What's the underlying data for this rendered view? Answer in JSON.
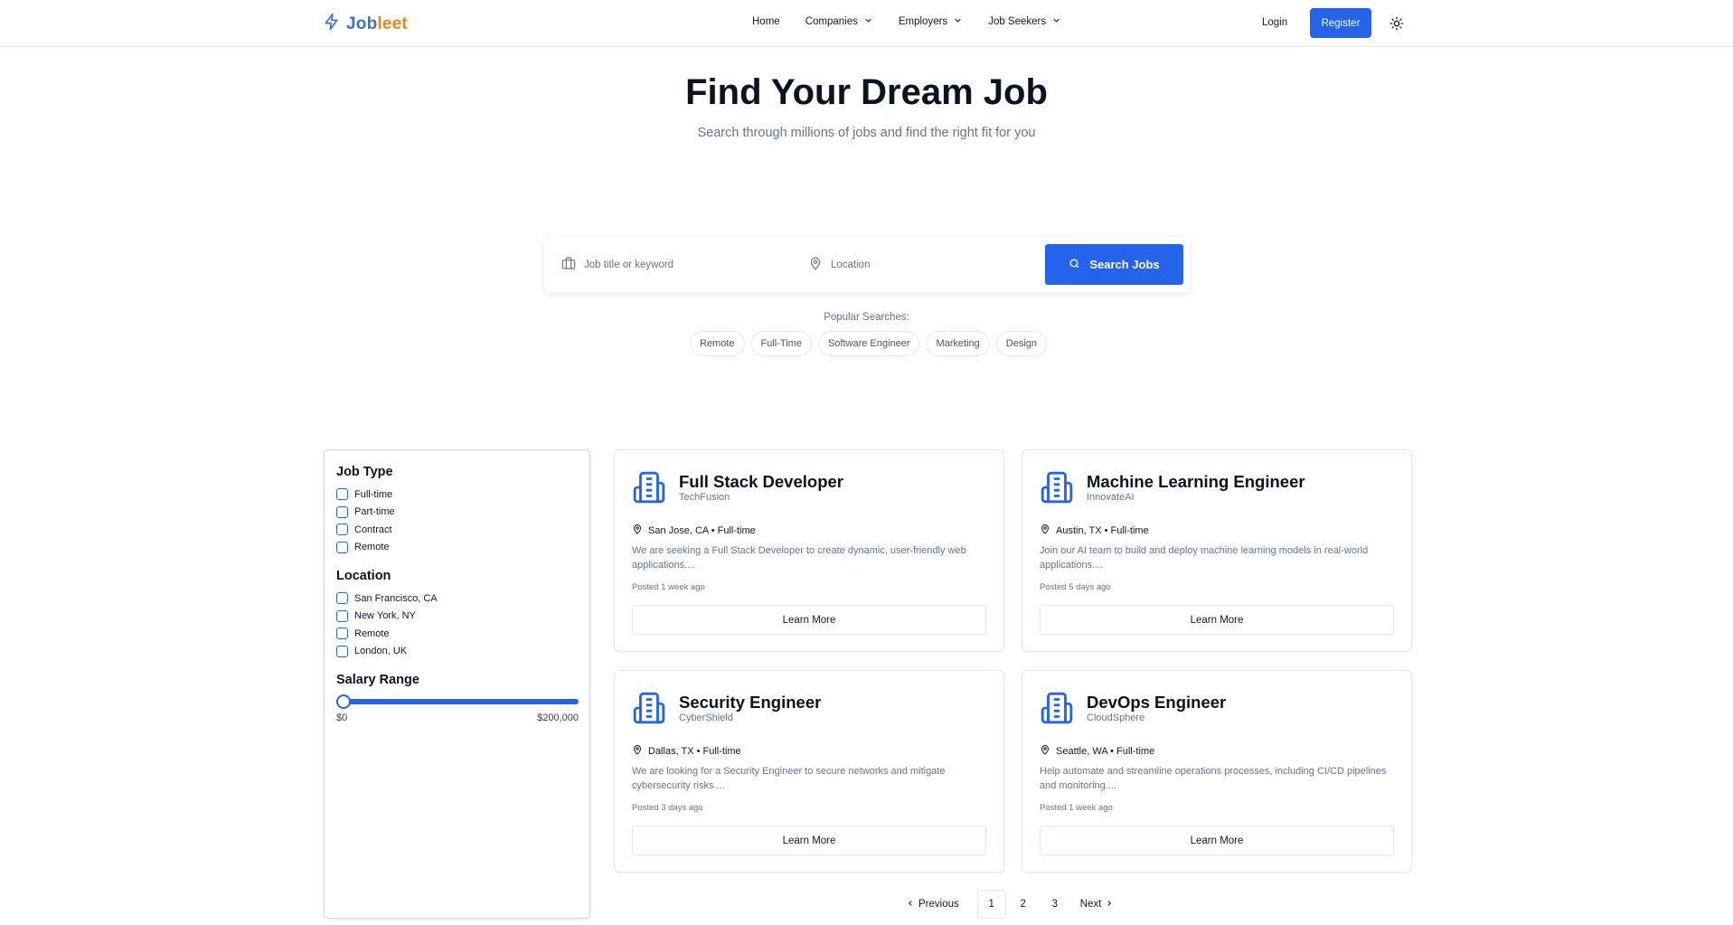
{
  "brand": {
    "part1": "Job",
    "part2": "leet",
    "color_primary": "#3b6fd6",
    "color_accent": "#e38a1d"
  },
  "nav": {
    "items": [
      {
        "label": "Home",
        "dropdown": false
      },
      {
        "label": "Companies",
        "dropdown": true
      },
      {
        "label": "Employers",
        "dropdown": true
      },
      {
        "label": "Job Seekers",
        "dropdown": true
      }
    ],
    "login": "Login",
    "register": "Register",
    "theme_icon": "sun-icon"
  },
  "hero": {
    "title": "Find Your Dream Job",
    "subtitle": "Search through millions of jobs and find the right fit for you"
  },
  "search": {
    "keyword_placeholder": "Job title or keyword",
    "location_placeholder": "Location",
    "button": "Search Jobs"
  },
  "popular": {
    "label": "Popular Searches:",
    "chips": [
      "Remote",
      "Full-Time",
      "Software Engineer",
      "Marketing",
      "Design"
    ]
  },
  "filters": {
    "job_type": {
      "title": "Job Type",
      "options": [
        "Full-time",
        "Part-time",
        "Contract",
        "Remote"
      ]
    },
    "location": {
      "title": "Location",
      "options": [
        "San Francisco, CA",
        "New York, NY",
        "Remote",
        "London, UK"
      ]
    },
    "salary": {
      "title": "Salary Range",
      "min_label": "$0",
      "max_label": "$200,000",
      "value_fraction": 0
    }
  },
  "jobs": [
    {
      "title": "Full Stack Developer",
      "company": "TechFusion",
      "meta": "San Jose, CA • Full-time",
      "description": "We are seeking a Full Stack Developer to create dynamic, user-friendly web applications....",
      "posted": "Posted 1 week ago",
      "cta": "Learn More"
    },
    {
      "title": "Machine Learning Engineer",
      "company": "InnovateAI",
      "meta": "Austin, TX • Full-time",
      "description": "Join our AI team to build and deploy machine learning models in real-world applications....",
      "posted": "Posted 5 days ago",
      "cta": "Learn More"
    },
    {
      "title": "Security Engineer",
      "company": "CyberShield",
      "meta": "Dallas, TX • Full-time",
      "description": "We are looking for a Security Engineer to secure networks and mitigate cybersecurity risks....",
      "posted": "Posted 3 days ago",
      "cta": "Learn More"
    },
    {
      "title": "DevOps Engineer",
      "company": "CloudSphere",
      "meta": "Seattle, WA • Full-time",
      "description": "Help automate and streamline operations processes, including CI/CD pipelines and monitoring....",
      "posted": "Posted 1 week ago",
      "cta": "Learn More"
    }
  ],
  "pagination": {
    "prev": "Previous",
    "pages": [
      "1",
      "2",
      "3"
    ],
    "current": "1",
    "next": "Next"
  },
  "colors": {
    "primary": "#2563eb",
    "muted": "#64748b",
    "border": "#e2e8f0"
  }
}
